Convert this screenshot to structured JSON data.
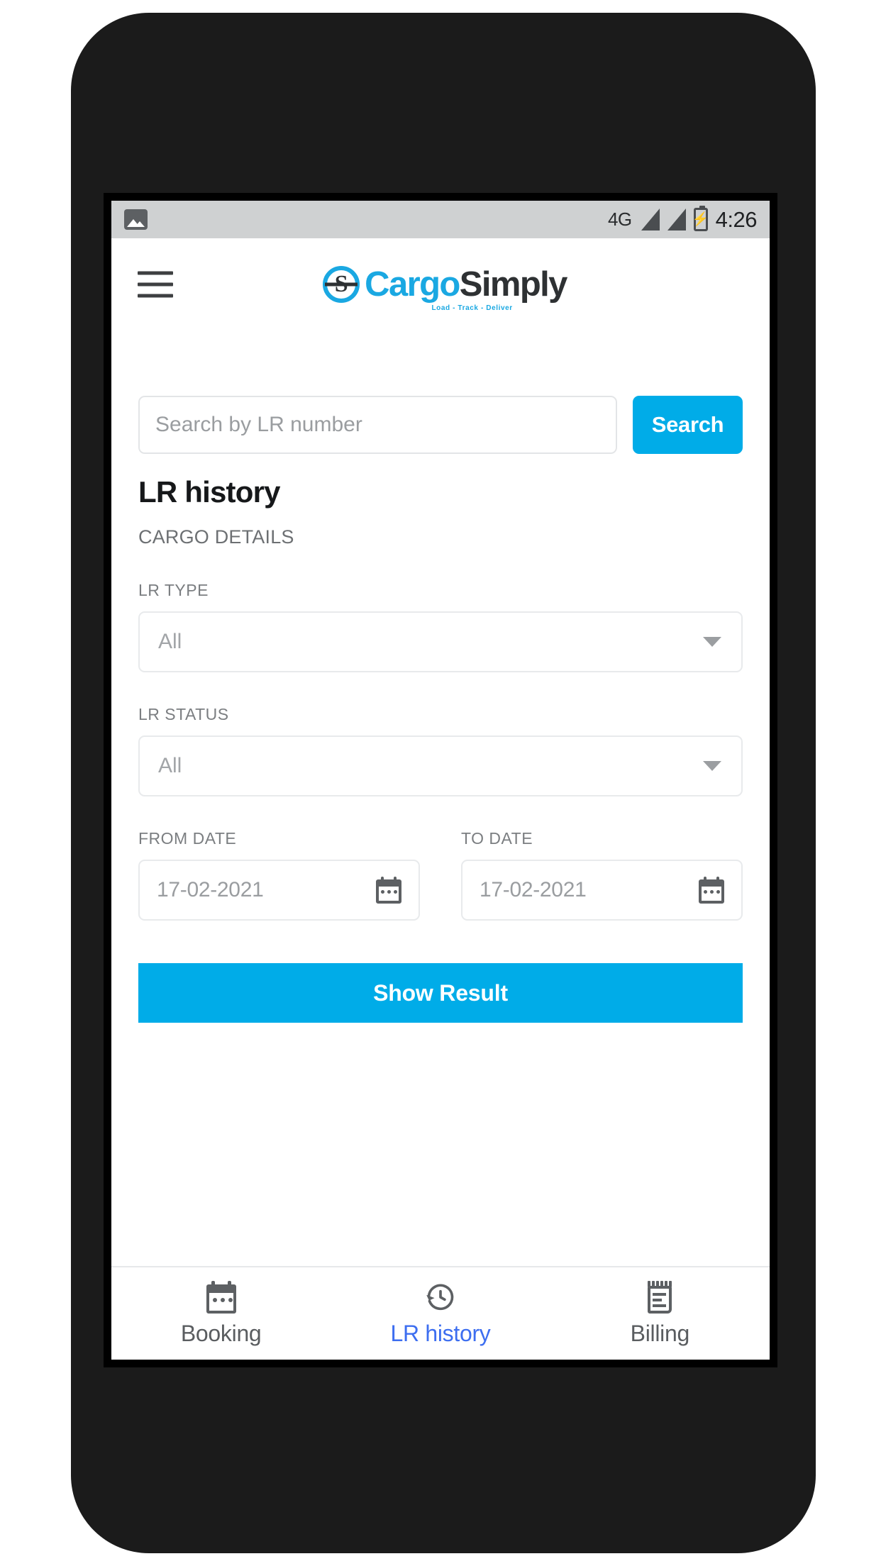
{
  "status_bar": {
    "gallery_icon": "image-icon",
    "network": "4G",
    "signal_icon": "signal-bars-icon",
    "battery_icon": "battery-charging-icon",
    "time": "4:26"
  },
  "header": {
    "menu_icon": "hamburger-menu-icon",
    "brand_mark": "S",
    "brand_first": "Cargo",
    "brand_second": "Simply",
    "tagline": "Load - Track - Deliver"
  },
  "search": {
    "placeholder": "Search by LR number",
    "value": "",
    "button_label": "Search"
  },
  "page": {
    "title": "LR history",
    "section_label": "CARGO DETAILS"
  },
  "filters": {
    "lr_type": {
      "label": "LR TYPE",
      "value": "All"
    },
    "lr_status": {
      "label": "LR STATUS",
      "value": "All"
    },
    "from_date": {
      "label": "FROM DATE",
      "value": "17-02-2021"
    },
    "to_date": {
      "label": "TO DATE",
      "value": "17-02-2021"
    },
    "submit_label": "Show Result"
  },
  "bottom_nav": {
    "items": [
      {
        "label": "Booking",
        "icon": "calendar-icon",
        "active": false
      },
      {
        "label": "LR history",
        "icon": "history-clock-icon",
        "active": true
      },
      {
        "label": "Billing",
        "icon": "receipt-icon",
        "active": false
      }
    ]
  },
  "colors": {
    "accent": "#00ACE8",
    "brand_blue": "#1AA8E2",
    "active_nav": "#3D6EF0",
    "phone_body": "#1B1B1B"
  }
}
